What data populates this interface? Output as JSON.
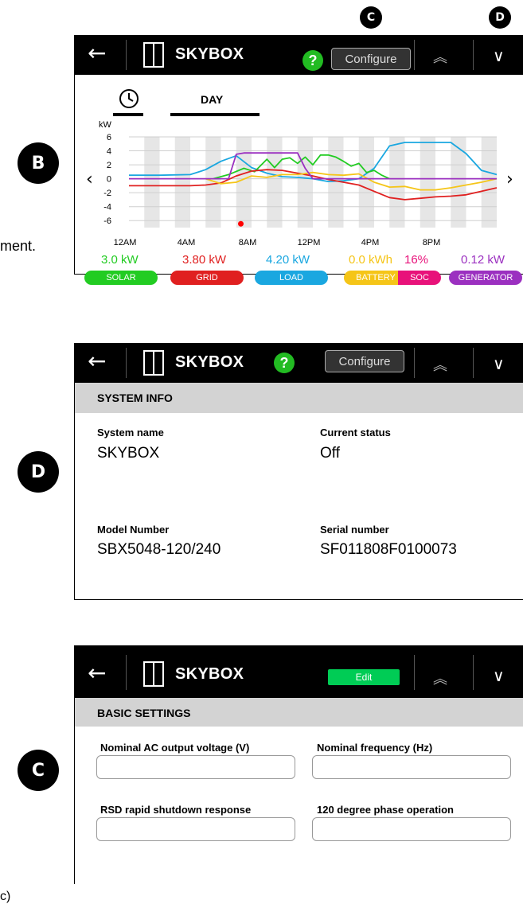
{
  "callouts": {
    "top_c": "C",
    "top_d": "D",
    "side_b": "B",
    "side_d": "D",
    "side_c": "C"
  },
  "fragments": {
    "ment": "ment.",
    "bottom": "c)"
  },
  "device": {
    "title": "SKYBOX",
    "configure_label": "Configure",
    "help_label": "?",
    "edit_label": "Edit",
    "back_arrow": "←",
    "up_chevron": "︽",
    "down_chevron": "∨"
  },
  "panel1": {
    "tabs": [
      {
        "icon": "clock-icon"
      },
      {
        "label": "DAY"
      }
    ],
    "chart_data": {
      "type": "line",
      "ylabel": "kW",
      "y_ticks": [
        "6",
        "4",
        "2",
        "0",
        "-2",
        "-4",
        "-6"
      ],
      "ylim": [
        -7,
        6
      ],
      "x_ticks": [
        "12AM",
        "4AM",
        "8AM",
        "12PM",
        "4PM",
        "8PM"
      ],
      "x_range_hours": [
        0,
        24
      ],
      "grid": true,
      "series": [
        {
          "name": "LOAD",
          "color": "#1aa7e0",
          "x": [
            0,
            2,
            4,
            5,
            6,
            7,
            8,
            9,
            10,
            11,
            12,
            13,
            14,
            15,
            16,
            17,
            18,
            19,
            20,
            21,
            22,
            23,
            24
          ],
          "y": [
            0.5,
            0.5,
            0.6,
            1.3,
            2.5,
            3.3,
            1.6,
            0.8,
            0.3,
            0.2,
            0,
            -0.4,
            -0.3,
            0,
            1.5,
            4.7,
            5.2,
            5.2,
            5.2,
            5.2,
            3.6,
            1.2,
            0.6
          ]
        },
        {
          "name": "SOLAR",
          "color": "#22cc22",
          "x": [
            5.5,
            6.5,
            7.5,
            8.2,
            9,
            9.5,
            10,
            10.5,
            11,
            11.5,
            12,
            12.5,
            13,
            13.5,
            14,
            14.5,
            15,
            15.5,
            16,
            16.5,
            17
          ],
          "y": [
            0,
            0.6,
            1.5,
            1.0,
            2.8,
            1.6,
            2.8,
            3.0,
            2.2,
            3.1,
            2.0,
            3.4,
            3.4,
            3.1,
            2.5,
            1.8,
            2.2,
            0.9,
            1.2,
            0.5,
            0
          ]
        },
        {
          "name": "GRID",
          "color": "#e02020",
          "x": [
            0,
            2,
            4,
            5,
            6,
            7,
            8,
            9,
            10,
            11,
            12,
            13,
            14,
            15,
            16,
            17,
            18,
            19,
            20,
            21,
            22,
            23,
            24
          ],
          "y": [
            -1,
            -1,
            -1,
            -0.9,
            -0.6,
            0.4,
            1.1,
            1.3,
            1.2,
            0.8,
            0.4,
            -0.1,
            -0.5,
            -0.9,
            -1.8,
            -2.7,
            -3.0,
            -2.8,
            -2.6,
            -2.5,
            -2.3,
            -1.8,
            -1.3
          ]
        },
        {
          "name": "BATTERY",
          "color": "#f5c518",
          "x": [
            5,
            6,
            7,
            8,
            9,
            10,
            11,
            12,
            13,
            14,
            15,
            16,
            17,
            18,
            19,
            20,
            21,
            22,
            23,
            24
          ],
          "y": [
            0,
            -0.7,
            -0.5,
            0.4,
            0.2,
            0.6,
            0.6,
            0.9,
            0.6,
            0.5,
            0.7,
            -0.5,
            -1.2,
            -1.1,
            -1.6,
            -1.6,
            -1.3,
            -0.9,
            -0.5,
            0
          ]
        },
        {
          "name": "GENERATOR",
          "color": "#9b30c0",
          "x": [
            0,
            6.5,
            7,
            7.5,
            9,
            10,
            11,
            11.5,
            12,
            24
          ],
          "y": [
            0,
            0,
            3.5,
            3.7,
            3.7,
            3.7,
            3.7,
            1.5,
            0,
            0
          ]
        }
      ],
      "marker": {
        "color": "#ff0000",
        "x": 7.3,
        "y": -6
      }
    },
    "values": {
      "solar": "3.0 kW",
      "grid": "3.80 kW",
      "load": "4.20 kW",
      "battery": "0.0 kWh",
      "soc": "16%",
      "generator": "0.12 kW"
    },
    "legend": {
      "solar": "SOLAR",
      "grid": "GRID",
      "load": "LOAD",
      "battery": "BATTERY",
      "soc": "SOC",
      "generator": "GENERATOR"
    },
    "colors": {
      "solar": "#22cc22",
      "grid": "#e02020",
      "load": "#1aa7e0",
      "battery": "#f5c518",
      "soc": "#e8127a",
      "generator": "#9b30c0"
    }
  },
  "panel2": {
    "section": "SYSTEM INFO",
    "fields": [
      {
        "label": "System name",
        "value": "SKYBOX"
      },
      {
        "label": "Current status",
        "value": "Off"
      },
      {
        "label": "Model Number",
        "value": "SBX5048-120/240"
      },
      {
        "label": "Serial number",
        "value": "SF011808F0100073"
      }
    ]
  },
  "panel3": {
    "section": "BASIC SETTINGS",
    "fields": [
      {
        "label": "Nominal AC output voltage (V)"
      },
      {
        "label": "Nominal frequency (Hz)"
      },
      {
        "label": "RSD rapid shutdown response"
      },
      {
        "label": "120 degree phase operation"
      }
    ]
  }
}
